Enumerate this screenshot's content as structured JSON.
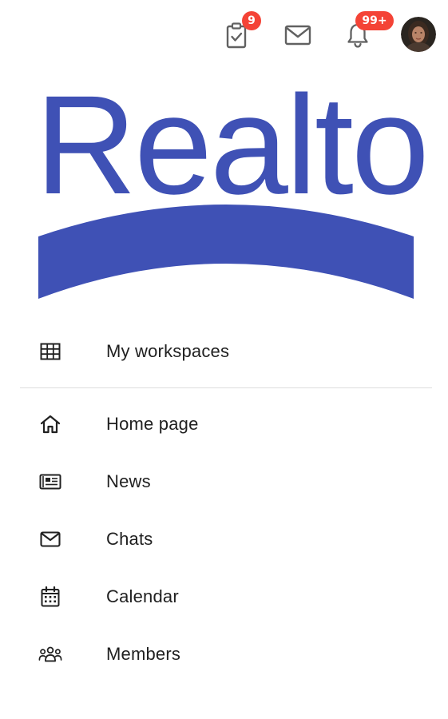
{
  "topbar": {
    "tasks": {
      "icon": "clipboard-check-icon",
      "badge": "9"
    },
    "messages": {
      "icon": "envelope-icon"
    },
    "notifications": {
      "icon": "bell-icon",
      "badge": "99+"
    },
    "avatar": {
      "icon": "user-avatar"
    }
  },
  "logo": {
    "text": "Realto",
    "color": "#3f51b5"
  },
  "nav": {
    "workspaces": {
      "label": "My workspaces",
      "icon": "grid-table-icon"
    },
    "items": [
      {
        "label": "Home page",
        "icon": "home-icon"
      },
      {
        "label": "News",
        "icon": "newspaper-icon"
      },
      {
        "label": "Chats",
        "icon": "envelope-icon"
      },
      {
        "label": "Calendar",
        "icon": "calendar-icon"
      },
      {
        "label": "Members",
        "icon": "group-icon"
      }
    ]
  },
  "colors": {
    "accent": "#3f51b5",
    "badge": "#f44336",
    "text": "#212121",
    "icon": "#616161"
  }
}
